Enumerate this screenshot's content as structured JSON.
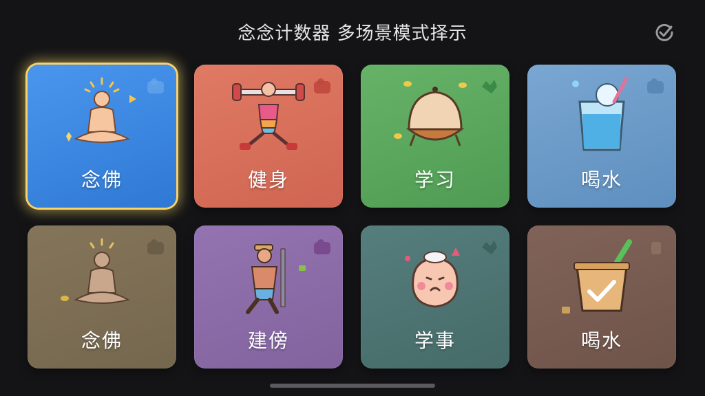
{
  "header": {
    "title": "念念计数器 多场景模式择示",
    "check_icon": "check-circle-icon"
  },
  "tiles": [
    {
      "label": "念佛",
      "icon": "meditation-icon",
      "color": "#3b86e0",
      "selected": true
    },
    {
      "label": "健身",
      "icon": "weightlifting-icon",
      "color": "#d9705a",
      "selected": false
    },
    {
      "label": "学习",
      "icon": "lamp-dome-icon",
      "color": "#5aa55e",
      "selected": false
    },
    {
      "label": "喝水",
      "icon": "water-glass-icon",
      "color": "#6a98c4",
      "selected": false
    },
    {
      "label": "念佛",
      "icon": "meditation-icon",
      "color": "#7e6f55",
      "selected": false
    },
    {
      "label": "建傍",
      "icon": "hiker-icon",
      "color": "#8b6aa6",
      "selected": false
    },
    {
      "label": "学事",
      "icon": "cute-face-icon",
      "color": "#4c7271",
      "selected": false
    },
    {
      "label": "喝水",
      "icon": "checked-cup-icon",
      "color": "#7a5e52",
      "selected": false
    }
  ]
}
